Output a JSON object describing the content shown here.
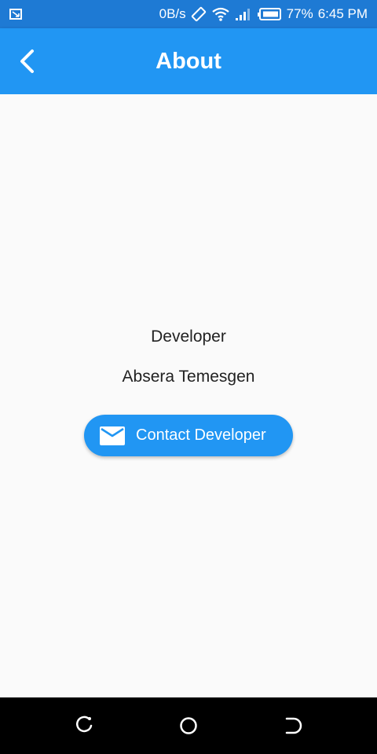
{
  "status_bar": {
    "network_speed": "0B/s",
    "battery": "77%",
    "time": "6:45 PM"
  },
  "app_bar": {
    "title": "About",
    "back_icon": "chevron-left-icon"
  },
  "content": {
    "developer_label": "Developer",
    "developer_name": "Absera Temesgen",
    "contact_button_label": "Contact Developer",
    "contact_icon": "mail-icon"
  },
  "colors": {
    "status_bar": "#1e7ad4",
    "app_bar": "#2196f3",
    "button": "#2196f3",
    "background": "#fafafa",
    "nav_bar": "#000000"
  },
  "nav_bar": {
    "icons": [
      "recents-icon",
      "home-icon",
      "back-icon"
    ]
  }
}
